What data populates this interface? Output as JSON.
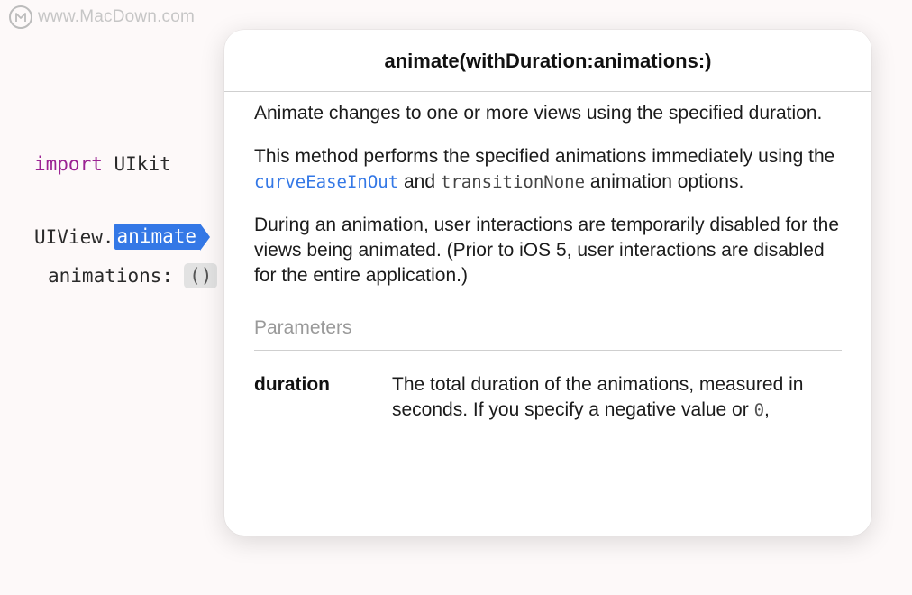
{
  "watermark": {
    "text": "www.MacDown.com",
    "logo_icon": "macdown-logo-icon"
  },
  "editor": {
    "import_keyword": "import",
    "import_module": "UIkit",
    "view_prefix": "UIView.",
    "selected_token": "animate",
    "animations_label": "animations:",
    "placeholder_token": "()",
    "colors": {
      "keyword": "#9b2393",
      "selection": "#3478e6"
    }
  },
  "quick_help": {
    "title": "animate(withDuration:animations:)",
    "summary": "Animate changes to one or more views using the specified duration.",
    "discussion1_before": "This method performs the specified animations immediately using the ",
    "code_link": "curveEaseInOut",
    "discussion1_mid": " and ",
    "code_plain": "transitionNone",
    "discussion1_after": " animation options.",
    "discussion2": "During an animation, user interactions are temporarily disabled for the views being animated. (Prior to iOS 5, user interactions are disabled for the entire application.)",
    "parameters_header": "Parameters",
    "parameters": [
      {
        "name": "duration",
        "desc_before": "The total duration of the animations, measured in seconds. If you specify a negative value or ",
        "desc_code": "0",
        "desc_after": ","
      }
    ]
  }
}
